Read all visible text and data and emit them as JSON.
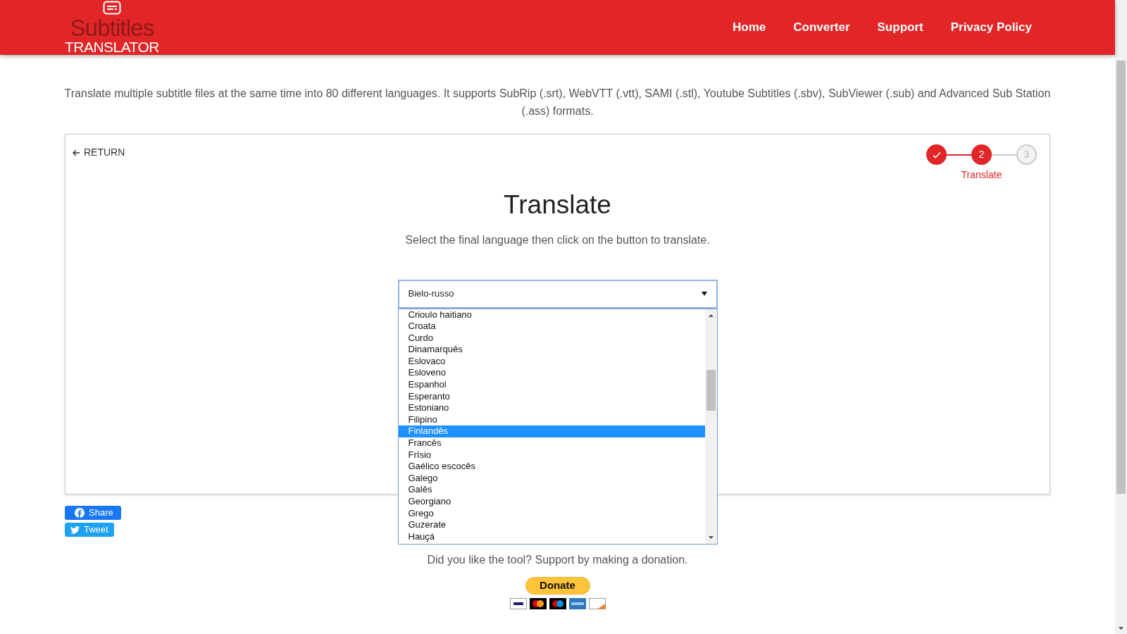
{
  "header": {
    "logo": {
      "line_1": "Subtitles",
      "line_2": "TRANSLATOR"
    },
    "nav": [
      {
        "label": "Home"
      },
      {
        "label": "Converter"
      },
      {
        "label": "Support"
      },
      {
        "label": "Privacy Policy"
      }
    ]
  },
  "description": "Translate multiple subtitle files at the same time into 80 different languages. It supports SubRip (.srt), WebVTT (.vtt), SAMI (.stl), Youtube Subtitles (.sbv), SubViewer (.sub) and Advanced Sub Station (.ass) formats.",
  "panel": {
    "return_link": "RETURN",
    "steps": [
      {
        "done": true,
        "active": false
      },
      {
        "done": false,
        "active": true,
        "number": "2",
        "label": "Translate"
      },
      {
        "done": false,
        "active": false,
        "number": "3"
      }
    ],
    "heading": "Translate",
    "instruction": "Select the final language then click on the button to translate.",
    "select": {
      "value": "Bielo-russo",
      "expanded": true,
      "options": [
        {
          "label": "Crioulo haitiano",
          "selected": false
        },
        {
          "label": "Croata",
          "selected": false
        },
        {
          "label": "Curdo",
          "selected": false
        },
        {
          "label": "Dinamarquês",
          "selected": false
        },
        {
          "label": "Eslovaco",
          "selected": false
        },
        {
          "label": "Esloveno",
          "selected": false
        },
        {
          "label": "Espanhol",
          "selected": false
        },
        {
          "label": "Esperanto",
          "selected": false
        },
        {
          "label": "Estoniano",
          "selected": false
        },
        {
          "label": "Filipino",
          "selected": false
        },
        {
          "label": "Finlandês",
          "selected": true
        },
        {
          "label": "Francês",
          "selected": false
        },
        {
          "label": "Frísio",
          "selected": false
        },
        {
          "label": "Gaélico escocês",
          "selected": false
        },
        {
          "label": "Galego",
          "selected": false
        },
        {
          "label": "Galês",
          "selected": false
        },
        {
          "label": "Georgiano",
          "selected": false
        },
        {
          "label": "Grego",
          "selected": false
        },
        {
          "label": "Guzerate",
          "selected": false
        },
        {
          "label": "Hauçá",
          "selected": false
        }
      ]
    }
  },
  "social": [
    {
      "kind": "facebook",
      "label": "Share"
    },
    {
      "kind": "twitter",
      "label": "Tweet"
    }
  ],
  "donation": {
    "text": "Did you like the tool? Support by making a donation.",
    "button": "Donate"
  }
}
